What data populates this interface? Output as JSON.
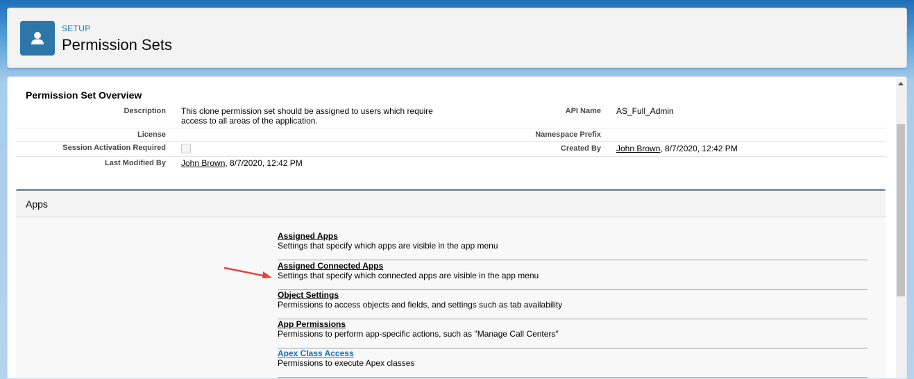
{
  "header": {
    "breadcrumb": "SETUP",
    "title": "Permission Sets",
    "icon": "user-icon"
  },
  "overview": {
    "title": "Permission Set Overview",
    "fields": {
      "description_label": "Description",
      "description_line1": "This clone permission set should be assigned to users which require",
      "description_line2": "access to all areas of the application.",
      "api_name_label": "API Name",
      "api_name_value": "AS_Full_Admin",
      "license_label": "License",
      "namespace_label": "Namespace Prefix",
      "session_label": "Session Activation Required",
      "session_checked": false,
      "created_by_label": "Created By",
      "created_by_user": "John Brown",
      "created_by_date": ", 8/7/2020, 12:42 PM",
      "modified_label": "Last Modified By",
      "modified_user": "John Brown",
      "modified_date": ", 8/7/2020, 12:42 PM"
    }
  },
  "apps": {
    "title": "Apps",
    "items": [
      {
        "label": "Assigned Apps",
        "desc": "Settings that specify which apps are visible in the app menu"
      },
      {
        "label": "Assigned Connected Apps",
        "desc": "Settings that specify which connected apps are visible in the app menu"
      },
      {
        "label": "Object Settings",
        "desc": "Permissions to access objects and fields, and settings such as tab availability"
      },
      {
        "label": "App Permissions",
        "desc": "Permissions to perform app-specific actions, such as \"Manage Call Centers\""
      },
      {
        "label": "Apex Class Access",
        "desc": "Permissions to execute Apex classes"
      }
    ]
  },
  "colors": {
    "accent": "#1b6fb5",
    "arrow": "#e8433a"
  }
}
